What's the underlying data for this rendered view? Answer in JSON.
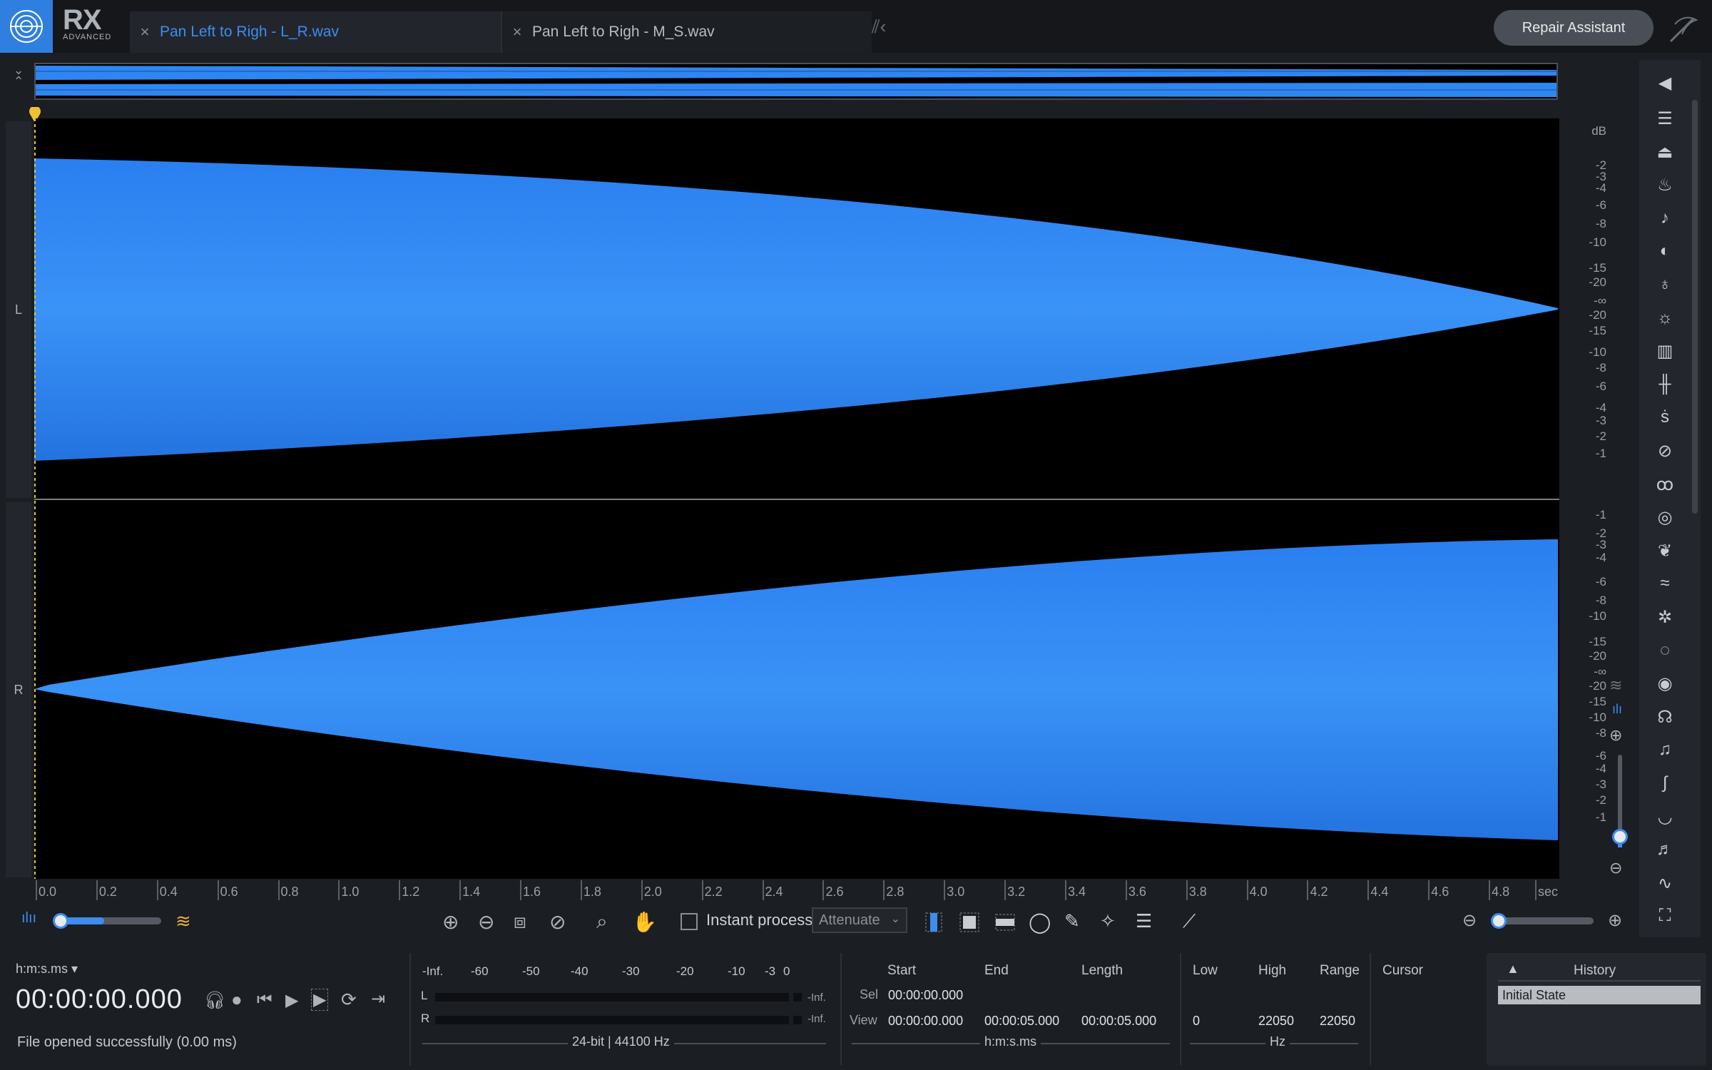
{
  "app": {
    "logo_text": "RX",
    "logo_sub": "ADVANCED"
  },
  "tabs": [
    {
      "label": "Pan Left to Righ - L_R.wav",
      "active": true
    },
    {
      "label": "Pan Left to Righ - M_S.wav",
      "active": false
    }
  ],
  "header": {
    "repair_assistant": "Repair Assistant"
  },
  "channels": {
    "left": "L",
    "right": "R"
  },
  "db_scale": {
    "unit": "dB",
    "top_channel": [
      "-2",
      "-3",
      "-4",
      "-6",
      "-8",
      "-10",
      "-15",
      "-20",
      "-∞",
      "-20",
      "-15",
      "-10",
      "-8",
      "-6",
      "-4",
      "-3",
      "-2",
      "-1"
    ],
    "bottom_channel": [
      "-1",
      "-2",
      "-3",
      "-4",
      "-6",
      "-8",
      "-10",
      "-15",
      "-20",
      "-∞",
      "-20",
      "-15",
      "-10",
      "-8",
      "-6",
      "-4",
      "-3",
      "-2",
      "-1"
    ]
  },
  "time_ruler": {
    "ticks": [
      "0.0",
      "0.2",
      "0.4",
      "0.6",
      "0.8",
      "1.0",
      "1.2",
      "1.4",
      "1.6",
      "1.8",
      "2.0",
      "2.2",
      "2.4",
      "2.6",
      "2.8",
      "3.0",
      "3.2",
      "3.4",
      "3.6",
      "3.8",
      "4.0",
      "4.2",
      "4.4",
      "4.6",
      "4.8"
    ],
    "unit": "sec"
  },
  "toolbar": {
    "instant_process": "Instant process",
    "mode": "Attenuate"
  },
  "transport": {
    "time_format": "h:m:s.ms",
    "timecode": "00:00:00.000",
    "status": "File opened successfully (0.00 ms)"
  },
  "meter": {
    "scale": [
      "-Inf.",
      "-60",
      "-50",
      "-40",
      "-30",
      "-20",
      "-10",
      "-3",
      "0"
    ],
    "left_label": "L",
    "right_label": "R",
    "left_peak": "-Inf.",
    "right_peak": "-Inf.",
    "format": "24-bit | 44100 Hz"
  },
  "selection": {
    "headers": {
      "start": "Start",
      "end": "End",
      "length": "Length"
    },
    "sel_label": "Sel",
    "view_label": "View",
    "sel_start": "00:00:00.000",
    "view_start": "00:00:00.000",
    "view_end": "00:00:05.000",
    "view_length": "00:00:05.000",
    "unit": "h:m:s.ms"
  },
  "frequency": {
    "headers": {
      "low": "Low",
      "high": "High",
      "range": "Range"
    },
    "low": "0",
    "high": "22050",
    "range": "22050",
    "unit": "Hz"
  },
  "cursor": {
    "label": "Cursor"
  },
  "history": {
    "title": "History",
    "items": [
      "Initial State"
    ]
  },
  "colors": {
    "accent": "#3d8cf0",
    "waveform": "#2e86f2",
    "background": "#1b1e23",
    "wave_bg": "#000000",
    "marker": "#f0c030"
  }
}
